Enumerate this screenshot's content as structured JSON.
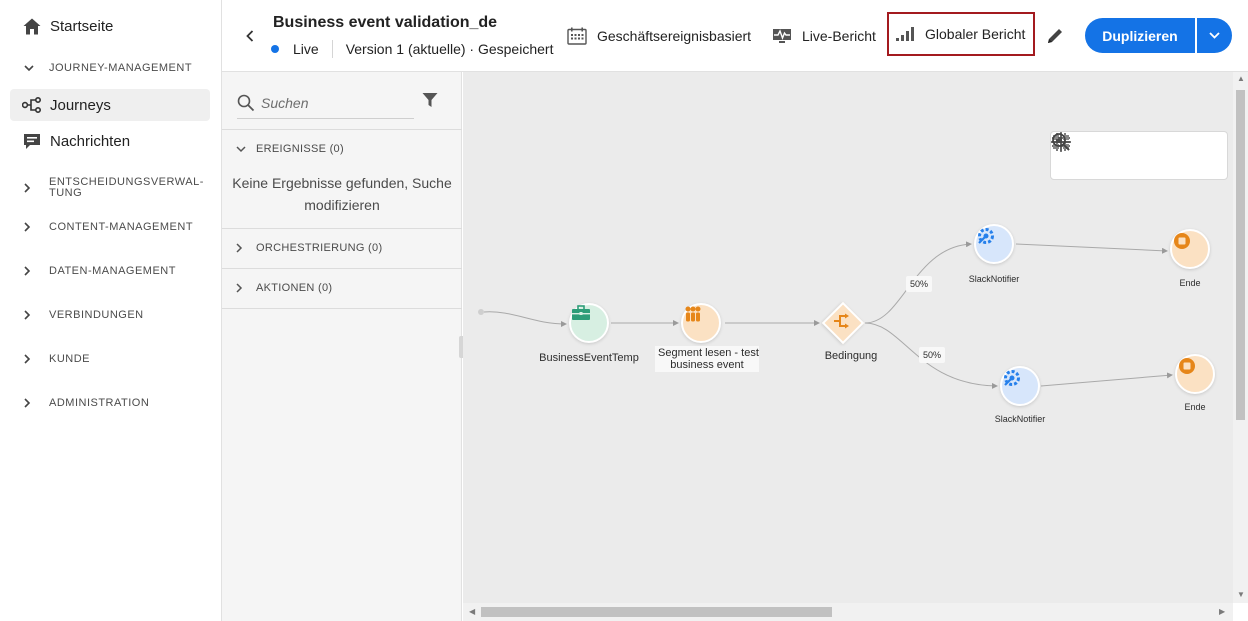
{
  "sidebar": {
    "home": {
      "label": "Startseite",
      "icon": "home-icon"
    },
    "journey_management": "JOURNEY-MANAGEMENT",
    "journeys": {
      "label": "Journeys",
      "icon": "journey-icon"
    },
    "messages": {
      "label": "Nachrichten",
      "icon": "message-icon"
    },
    "decision_l1": "ENTSCHEIDUNGSVERWAL-",
    "decision_l2": "TUNG",
    "content": "CONTENT-MANAGEMENT",
    "data": "DATEN-MANAGEMENT",
    "connections": "VERBINDUNGEN",
    "customer": "KUNDE",
    "admin": "ADMINISTRATION"
  },
  "header": {
    "title": "Business event validation_de",
    "status": "Live",
    "version": "Version 1 (aktuelle) · Gespeichert",
    "btn_business": "Geschäftsereignisbasiert",
    "btn_live": "Live-Bericht",
    "btn_global": "Globaler Bericht",
    "btn_duplicate": "Duplizieren"
  },
  "panel": {
    "search_placeholder": "Suchen",
    "events": "EREIGNISSE (0)",
    "no_results": "Keine Ergebnisse gefunden, Suche modifizieren",
    "orchestration": "ORCHESTRIERUNG (0)",
    "actions": "AKTIONEN (0)"
  },
  "canvas": {
    "nodes": {
      "business_event": "BusinessEventTemp",
      "segment_l1": "Segment lesen - test",
      "segment_l2": "business event",
      "condition": "Bedingung",
      "slack_top": "SlackNotifier",
      "end_top": "Ende",
      "slack_bottom": "SlackNotifier",
      "end_bottom": "Ende"
    },
    "pct_top": "50%",
    "pct_bottom": "50%"
  },
  "colors": {
    "accent": "#1473e6",
    "highlight_border": "#a31a1f",
    "green_node": "#2d9d78",
    "orange_node": "#e68619",
    "blue_node": "#2680eb"
  }
}
